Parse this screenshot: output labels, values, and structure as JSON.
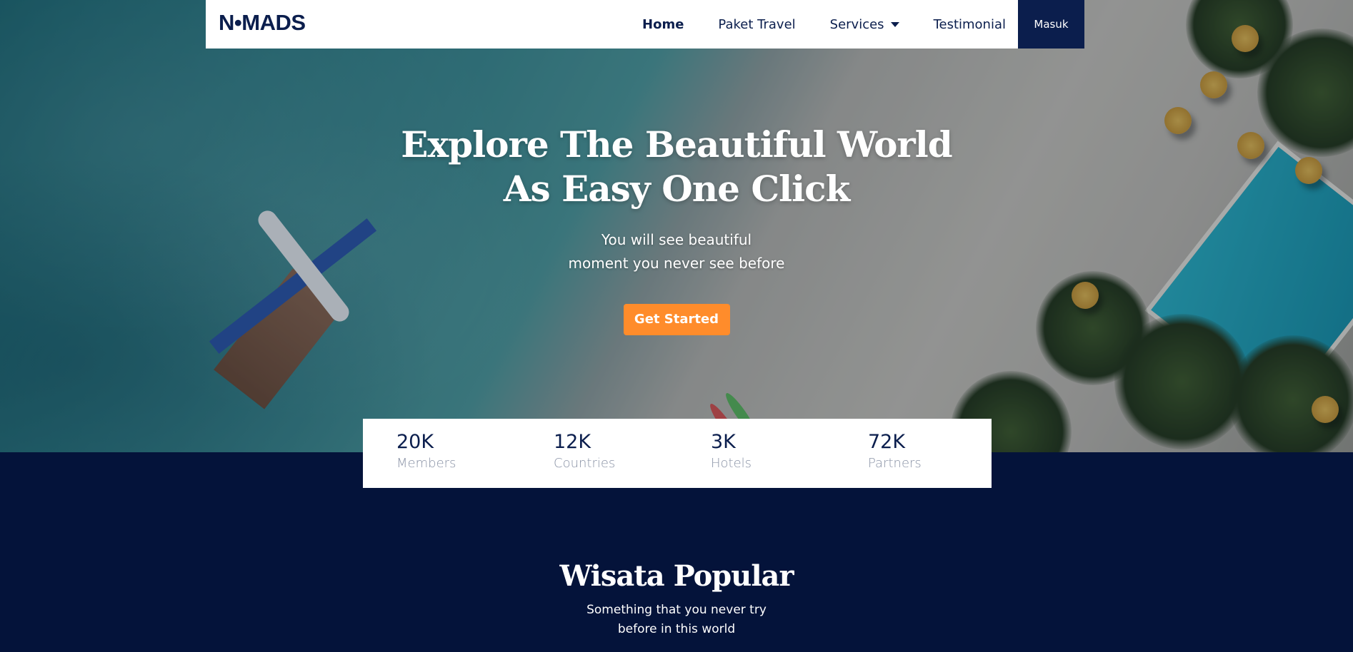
{
  "navbar": {
    "brand": "N•MADS",
    "links": [
      {
        "label": "Home",
        "active": true
      },
      {
        "label": "Paket Travel",
        "active": false
      },
      {
        "label": "Services",
        "active": false,
        "has_dropdown": true
      },
      {
        "label": "Testimonial",
        "active": false
      }
    ],
    "login_label": "Masuk"
  },
  "hero": {
    "title_line1": "Explore The Beautiful World",
    "title_line2": "As Easy One Click",
    "subtitle_line1": "You will see beautiful",
    "subtitle_line2": "moment you never see before",
    "cta_label": "Get Started"
  },
  "stats": [
    {
      "value": "20K",
      "label": "Members"
    },
    {
      "value": "12K",
      "label": "Countries"
    },
    {
      "value": "3K",
      "label": "Hotels"
    },
    {
      "value": "72K",
      "label": "Partners"
    }
  ],
  "popular": {
    "title": "Wisata Popular",
    "subtitle_line1": "Something that you never try",
    "subtitle_line2": "before in this world"
  },
  "colors": {
    "primary": "#0b1e4d",
    "accent": "#ff8c2b",
    "section_bg": "#04133a",
    "stat_label": "#8a93a6"
  }
}
